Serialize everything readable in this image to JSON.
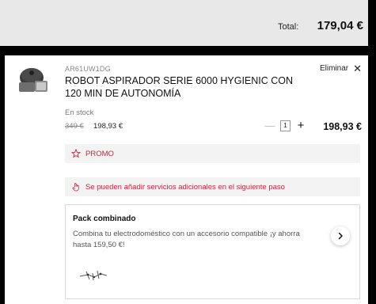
{
  "summary": {
    "total_label": "Total:",
    "total_value": "179,04 €"
  },
  "product": {
    "sku": "AR61UW1DG",
    "name": "ROBOT ASPIRADOR SERIE 6000 HYGIENIC CON 120 MIN DE AUTONOMÍA",
    "remove_label": "Eliminar",
    "stock": "En stock",
    "old_price": "349 €",
    "new_price": "198,93 €",
    "quantity": "1",
    "line_total": "198,93 €"
  },
  "promo": {
    "label": "PROMO",
    "icon": "star-icon"
  },
  "services": {
    "text": "Se pueden añadir servicios adicionales en el siguiente paso",
    "icon": "hand-pointer-icon"
  },
  "pack": {
    "title": "Pack combinado",
    "description": "Combina tu electrodoméstico con un accesorio compatible ¡y ahorra hasta 159,50 €!"
  },
  "colors": {
    "accent_red": "#c4283a",
    "background": "#000000",
    "total_bar": "#e8e8e8"
  }
}
